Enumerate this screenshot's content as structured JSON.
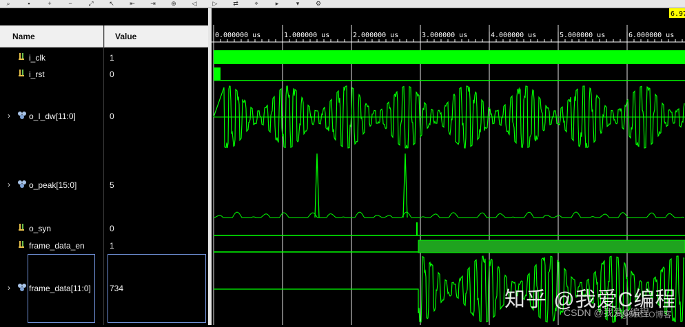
{
  "toolbar": {
    "buttons": [
      "search-icon",
      "save-icon",
      "zoom-in-icon",
      "zoom-out-icon",
      "zoom-fit-icon",
      "cursor-icon",
      "prev-edge-icon",
      "next-edge-icon",
      "add-marker-icon",
      "prev-marker-icon",
      "next-marker-icon",
      "swap-cursor-icon",
      "snap-icon",
      "expand-icon",
      "collapse-icon",
      "settings-icon"
    ]
  },
  "columns": {
    "name": "Name",
    "value": "Value"
  },
  "signals": [
    {
      "name": "i_clk",
      "value": "1",
      "expandable": false,
      "icon": "bit-signal-icon"
    },
    {
      "name": "i_rst",
      "value": "0",
      "expandable": false,
      "icon": "bit-signal-icon"
    },
    {
      "name": "o_I_dw[11:0]",
      "value": "0",
      "expandable": true,
      "icon": "bus-signal-icon"
    },
    {
      "name": "o_peak[15:0]",
      "value": "5",
      "expandable": true,
      "icon": "bus-signal-icon"
    },
    {
      "name": "o_syn",
      "value": "0",
      "expandable": false,
      "icon": "bit-signal-icon"
    },
    {
      "name": "frame_data_en",
      "value": "1",
      "expandable": false,
      "icon": "bit-signal-icon"
    },
    {
      "name": "frame_data[11:0]",
      "value": "734",
      "expandable": true,
      "icon": "bus-signal-icon",
      "selected": true
    }
  ],
  "timeline": {
    "cursor_label": "6.97",
    "tick_labels": [
      "0.000000 us",
      "1.000000 us",
      "2.000000 us",
      "3.000000 us",
      "4.000000 us",
      "5.000000 us",
      "6.000000 us"
    ],
    "tick_values_us": [
      0,
      1,
      2,
      3,
      4,
      5,
      6
    ],
    "view_range_us": [
      0,
      6.8
    ],
    "cursor_us": 6.97
  },
  "waveform": {
    "color": "#00ff00",
    "background": "#000000",
    "i_rst_deassert_us": 0.1,
    "o_syn_pulse_us": 2.95,
    "frame_data_en_rise_us": 2.97
  },
  "watermark": {
    "main": "知乎 @我爱C编程",
    "sub": "CSDN @我爱C编程",
    "corner": "@51CTO博客"
  },
  "colors": {
    "wave": "#00ff00",
    "grid": "#ffffff",
    "selection": "#6f8fd6",
    "cursor_bg": "#ffff00"
  }
}
